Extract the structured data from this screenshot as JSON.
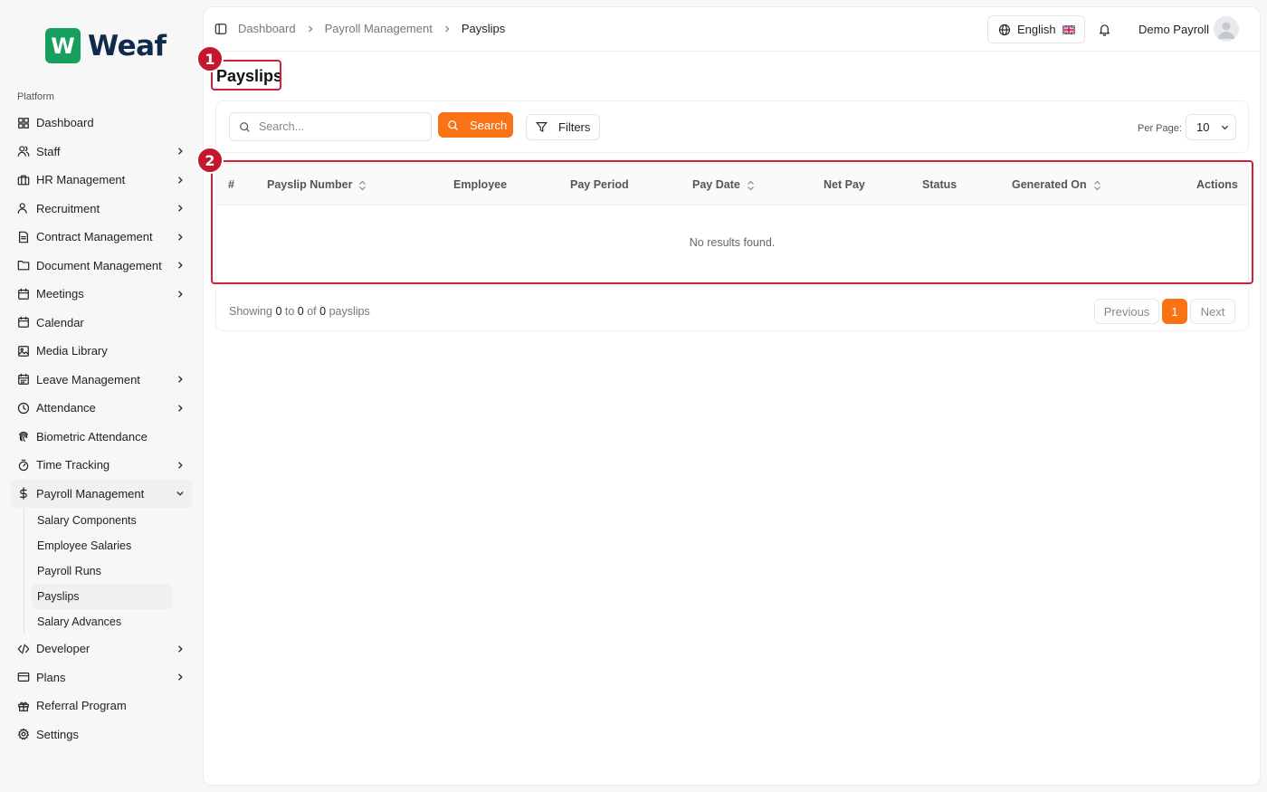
{
  "brand": {
    "logo_letter": "W",
    "name": "Weaf",
    "color": "#17a05d"
  },
  "sidebar": {
    "section_label": "Platform",
    "items": [
      {
        "label": "Dashboard",
        "icon": "dashboard-icon",
        "has_children": false
      },
      {
        "label": "Staff",
        "icon": "users-icon",
        "has_children": true
      },
      {
        "label": "HR Management",
        "icon": "briefcase-icon",
        "has_children": true
      },
      {
        "label": "Recruitment",
        "icon": "user-plus-icon",
        "has_children": true
      },
      {
        "label": "Contract Management",
        "icon": "file-text-icon",
        "has_children": true
      },
      {
        "label": "Document Management",
        "icon": "folder-icon",
        "has_children": true
      },
      {
        "label": "Meetings",
        "icon": "calendar-icon",
        "has_children": true
      },
      {
        "label": "Calendar",
        "icon": "calendar-icon",
        "has_children": false
      },
      {
        "label": "Media Library",
        "icon": "image-icon",
        "has_children": false
      },
      {
        "label": "Leave Management",
        "icon": "calendar-days-icon",
        "has_children": true
      },
      {
        "label": "Attendance",
        "icon": "clock-icon",
        "has_children": true
      },
      {
        "label": "Biometric Attendance",
        "icon": "fingerprint-icon",
        "has_children": false
      },
      {
        "label": "Time Tracking",
        "icon": "timer-icon",
        "has_children": true
      },
      {
        "label": "Payroll Management",
        "icon": "dollar-icon",
        "has_children": true,
        "expanded": true
      }
    ],
    "payroll_children": [
      "Salary Components",
      "Employee Salaries",
      "Payroll Runs",
      "Payslips",
      "Salary Advances"
    ],
    "active_child": "Payslips",
    "items_after": [
      {
        "label": "Developer",
        "icon": "code-icon",
        "has_children": true
      },
      {
        "label": "Plans",
        "icon": "credit-card-icon",
        "has_children": true
      },
      {
        "label": "Referral Program",
        "icon": "gift-icon",
        "has_children": false
      },
      {
        "label": "Settings",
        "icon": "gear-icon",
        "has_children": false
      }
    ]
  },
  "header": {
    "breadcrumb": [
      "Dashboard",
      "Payroll Management",
      "Payslips"
    ],
    "language": "English",
    "user_name": "Demo Payroll"
  },
  "page": {
    "title": "Payslips"
  },
  "toolbar": {
    "search_placeholder": "Search...",
    "search_button": "Search",
    "filters_button": "Filters",
    "per_page_label": "Per Page:",
    "per_page_value": "10"
  },
  "table": {
    "columns": [
      {
        "label": "#",
        "sortable": false
      },
      {
        "label": "Payslip Number",
        "sortable": true
      },
      {
        "label": "Employee",
        "sortable": false
      },
      {
        "label": "Pay Period",
        "sortable": false
      },
      {
        "label": "Pay Date",
        "sortable": true
      },
      {
        "label": "Net Pay",
        "sortable": false
      },
      {
        "label": "Status",
        "sortable": false
      },
      {
        "label": "Generated On",
        "sortable": true
      },
      {
        "label": "Actions",
        "sortable": false
      }
    ],
    "rows": [],
    "empty_text": "No results found."
  },
  "footer": {
    "showing_prefix": "Showing",
    "from": "0",
    "to_word": "to",
    "to": "0",
    "of_word": "of",
    "total": "0",
    "suffix": "payslips",
    "prev_label": "Previous",
    "current_page": "1",
    "next_label": "Next"
  },
  "annotations": [
    "1",
    "2"
  ],
  "colors": {
    "accent": "#f97316",
    "annotation": "#c4162e"
  }
}
